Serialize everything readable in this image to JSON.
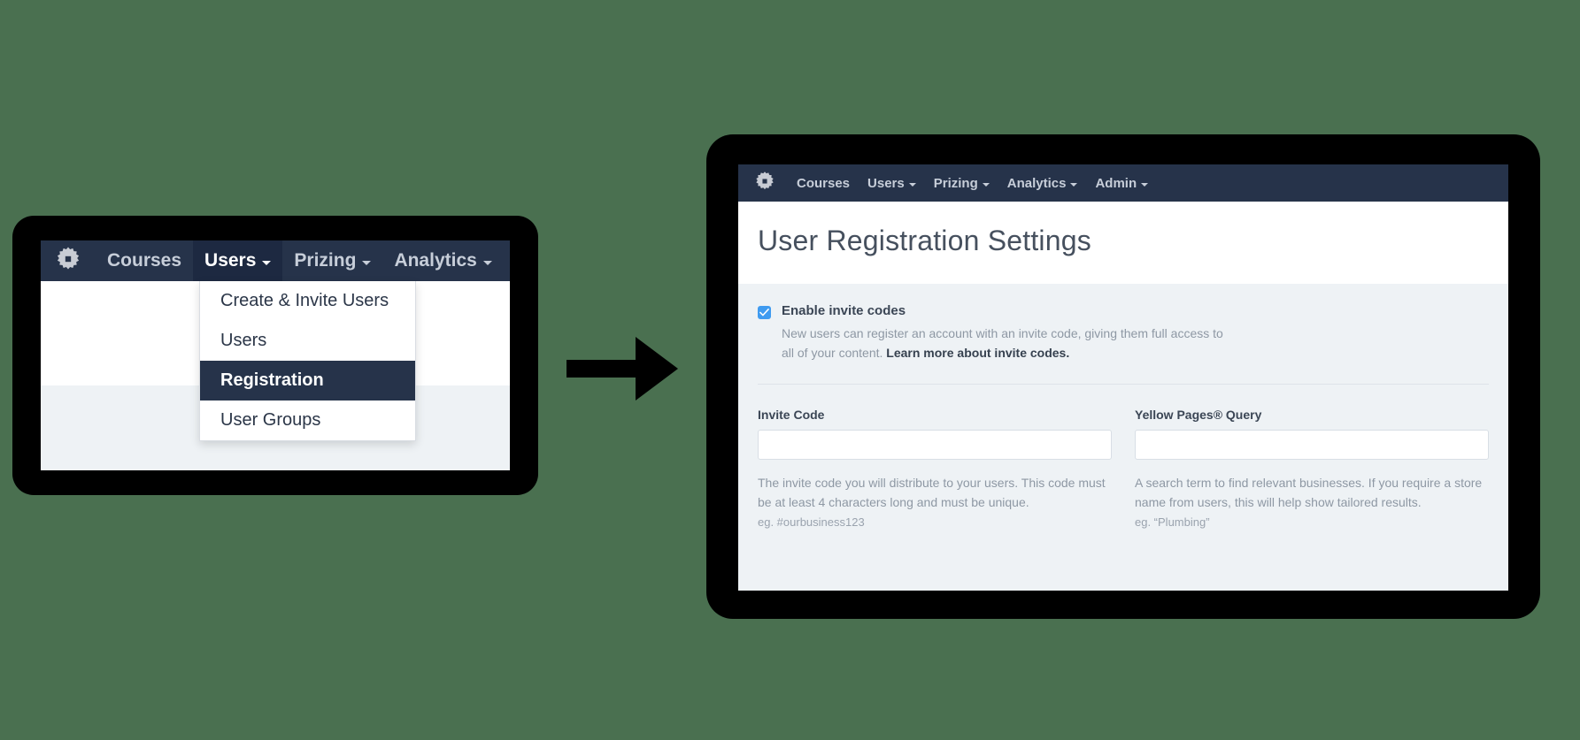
{
  "theme": {
    "page_background": "#4a7050",
    "navbar_background": "#26334a",
    "navbar_active_background": "#1d2941",
    "content_background": "#eef2f5",
    "checkbox_accent": "#3f9bf0",
    "device_bezel": "#000000"
  },
  "left_panel": {
    "navbar": {
      "logo_icon": "gear-icon",
      "items": [
        {
          "label": "Courses",
          "has_caret": false,
          "active": false
        },
        {
          "label": "Users",
          "has_caret": true,
          "active": true
        },
        {
          "label": "Prizing",
          "has_caret": true,
          "active": false
        },
        {
          "label": "Analytics",
          "has_caret": true,
          "active": false
        }
      ]
    },
    "dropdown": {
      "items": [
        {
          "label": "Create & Invite Users",
          "selected": false
        },
        {
          "label": "Users",
          "selected": false
        },
        {
          "label": "Registration",
          "selected": true
        },
        {
          "label": "User Groups",
          "selected": false
        }
      ]
    }
  },
  "arrow": {
    "icon": "arrow-right-icon",
    "color": "#000000"
  },
  "right_panel": {
    "navbar": {
      "logo_icon": "gear-icon",
      "items": [
        {
          "label": "Courses",
          "has_caret": false
        },
        {
          "label": "Users",
          "has_caret": true
        },
        {
          "label": "Prizing",
          "has_caret": true
        },
        {
          "label": "Analytics",
          "has_caret": true
        },
        {
          "label": "Admin",
          "has_caret": true
        }
      ]
    },
    "page_title": "User Registration Settings",
    "invite_setting": {
      "checkbox_checked": true,
      "title": "Enable invite codes",
      "description_before_link": "New users can register an account with an invite code, giving them full access to all of your content. ",
      "link_text": "Learn more about invite codes."
    },
    "fields": [
      {
        "label": "Invite Code",
        "value": "",
        "placeholder": "",
        "help": "The invite code you will distribute to your users. This code must be at least 4 characters long and must be unique.",
        "example": "eg. #ourbusiness123"
      },
      {
        "label": "Yellow Pages® Query",
        "value": "",
        "placeholder": "",
        "help": "A search term to find relevant businesses. If you require a store name from users, this will help show tailored results.",
        "example": "eg. “Plumbing”"
      }
    ]
  }
}
